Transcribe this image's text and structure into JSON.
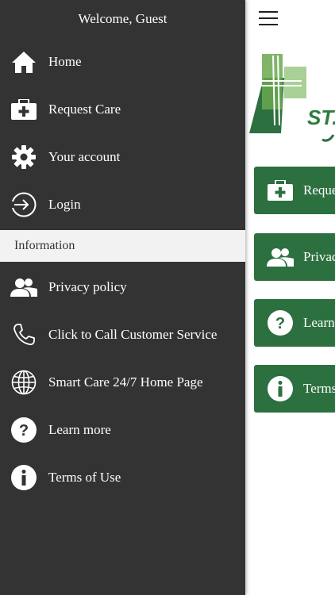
{
  "drawer": {
    "welcome": "Welcome, Guest",
    "items": [
      {
        "label": "Home",
        "icon": "home-icon"
      },
      {
        "label": "Request Care",
        "icon": "medical-kit-icon"
      },
      {
        "label": "Your account",
        "icon": "gear-icon"
      },
      {
        "label": "Login",
        "icon": "login-icon"
      }
    ],
    "section_title": "Information",
    "info_items": [
      {
        "label": "Privacy policy",
        "icon": "users-icon"
      },
      {
        "label": "Click to Call Customer Service",
        "icon": "phone-icon"
      },
      {
        "label": "Smart Care 24/7 Home Page",
        "icon": "globe-icon"
      },
      {
        "label": "Learn more",
        "icon": "question-icon"
      },
      {
        "label": "Terms of Use",
        "icon": "info-icon"
      }
    ]
  },
  "main": {
    "logo_text": "ST.",
    "tiles": [
      {
        "label": "Reque",
        "icon": "medical-kit-icon"
      },
      {
        "label": "Privac",
        "icon": "users-icon"
      },
      {
        "label": "Learn",
        "icon": "question-icon"
      },
      {
        "label": "Terms",
        "icon": "info-icon"
      }
    ]
  },
  "colors": {
    "drawer_bg": "#333333",
    "section_bg": "#f2f2f2",
    "tile_green": "#2d7040",
    "logo_green": "#2d7d3f"
  }
}
